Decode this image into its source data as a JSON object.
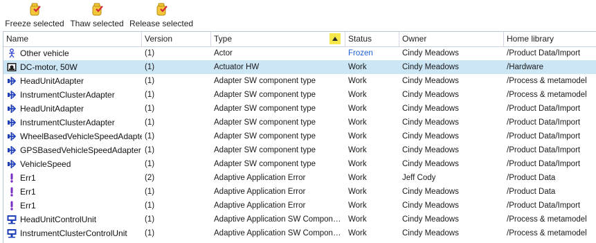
{
  "toolbar": {
    "freeze_label": "Freeze selected",
    "thaw_label": "Thaw selected",
    "release_label": "Release selected"
  },
  "columns": {
    "name": "Name",
    "version": "Version",
    "type": "Type",
    "status": "Status",
    "owner": "Owner",
    "home": "Home library"
  },
  "sort": {
    "column": "type",
    "direction": "ascending"
  },
  "colors": {
    "selected_row": "#cce6f5",
    "sort_highlight": "#f6e74a",
    "frozen_status": "#1b5fcf",
    "icon_blue": "#1f3fb8",
    "icon_purple": "#7a2cc7"
  },
  "rows": [
    {
      "icon": "actor-icon",
      "name": "Other vehicle",
      "version": "(1)",
      "type": "Actor",
      "status": "Frozen",
      "owner": "Cindy Meadows",
      "home": "/Product Data/Import",
      "selected": false
    },
    {
      "icon": "hardware-icon",
      "name": "DC-motor, 50W",
      "version": "(1)",
      "type": "Actuator HW",
      "status": "Work",
      "owner": "Cindy Meadows",
      "home": "/Hardware",
      "selected": true
    },
    {
      "icon": "adapter-icon",
      "name": "HeadUnitAdapter",
      "version": "(1)",
      "type": "Adapter SW component type",
      "status": "Work",
      "owner": "Cindy Meadows",
      "home": "/Process & metamodel",
      "selected": false
    },
    {
      "icon": "adapter-icon",
      "name": "InstrumentClusterAdapter",
      "version": "(1)",
      "type": "Adapter SW component type",
      "status": "Work",
      "owner": "Cindy Meadows",
      "home": "/Process & metamodel",
      "selected": false
    },
    {
      "icon": "adapter-icon",
      "name": "HeadUnitAdapter",
      "version": "(1)",
      "type": "Adapter SW component type",
      "status": "Work",
      "owner": "Cindy Meadows",
      "home": "/Product Data/Import",
      "selected": false
    },
    {
      "icon": "adapter-icon",
      "name": "InstrumentClusterAdapter",
      "version": "(1)",
      "type": "Adapter SW component type",
      "status": "Work",
      "owner": "Cindy Meadows",
      "home": "/Product Data/Import",
      "selected": false
    },
    {
      "icon": "adapter-icon",
      "name": "WheelBasedVehicleSpeedAdapter",
      "version": "(1)",
      "type": "Adapter SW component type",
      "status": "Work",
      "owner": "Cindy Meadows",
      "home": "/Product Data/Import",
      "selected": false
    },
    {
      "icon": "adapter-icon",
      "name": "GPSBasedVehicleSpeedAdapter",
      "version": "(1)",
      "type": "Adapter SW component type",
      "status": "Work",
      "owner": "Cindy Meadows",
      "home": "/Product Data/Import",
      "selected": false
    },
    {
      "icon": "adapter-icon",
      "name": "VehicleSpeed",
      "version": "(1)",
      "type": "Adapter SW component type",
      "status": "Work",
      "owner": "Cindy Meadows",
      "home": "/Product Data/Import",
      "selected": false
    },
    {
      "icon": "error-icon",
      "name": "Err1",
      "version": "(2)",
      "type": "Adaptive Application Error",
      "status": "Work",
      "owner": "Jeff Cody",
      "home": "/Product Data",
      "selected": false
    },
    {
      "icon": "error-icon",
      "name": "Err1",
      "version": "(1)",
      "type": "Adaptive Application Error",
      "status": "Work",
      "owner": "Cindy Meadows",
      "home": "/Product Data",
      "selected": false
    },
    {
      "icon": "error-icon",
      "name": "Err1",
      "version": "(1)",
      "type": "Adaptive Application Error",
      "status": "Work",
      "owner": "Cindy Meadows",
      "home": "/Product Data/Import",
      "selected": false
    },
    {
      "icon": "control-unit-icon",
      "name": "HeadUnitControlUnit",
      "version": "(1)",
      "type": "Adaptive Application SW Compon…",
      "status": "Work",
      "owner": "Cindy Meadows",
      "home": "/Process & metamodel",
      "selected": false
    },
    {
      "icon": "control-unit-icon",
      "name": "InstrumentClusterControlUnit",
      "version": "(1)",
      "type": "Adaptive Application SW Compon…",
      "status": "Work",
      "owner": "Cindy Meadows",
      "home": "/Process & metamodel",
      "selected": false
    }
  ]
}
